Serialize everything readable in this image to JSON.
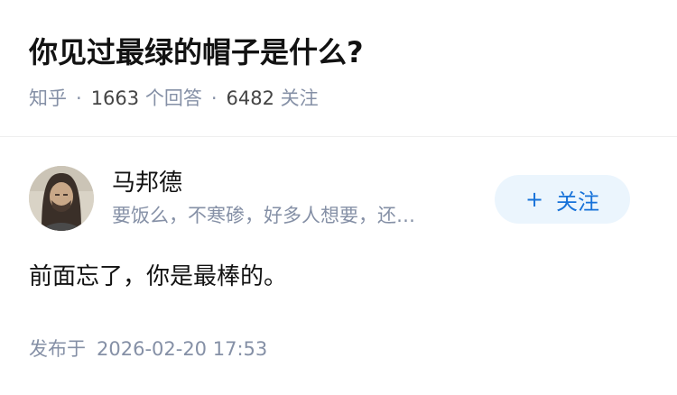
{
  "question": {
    "title": "你见过最绿的帽子是什么?",
    "source": "知乎",
    "separator": "·",
    "answer_count": "1663",
    "answer_label": "个回答",
    "follow_count": "6482",
    "follow_label": "关注"
  },
  "author": {
    "name": "马邦德",
    "bio": "要饭么，不寒碜，好多人想要，还…",
    "avatar_icon": "user-avatar-photo"
  },
  "follow_button": {
    "icon": "+",
    "label": "关注",
    "accent": "#1772d9",
    "background": "#ebf5fd"
  },
  "answer": {
    "content": "前面忘了，你是最棒的。",
    "published_label": "发布于",
    "published_time": "2026-02-20 17:53"
  }
}
